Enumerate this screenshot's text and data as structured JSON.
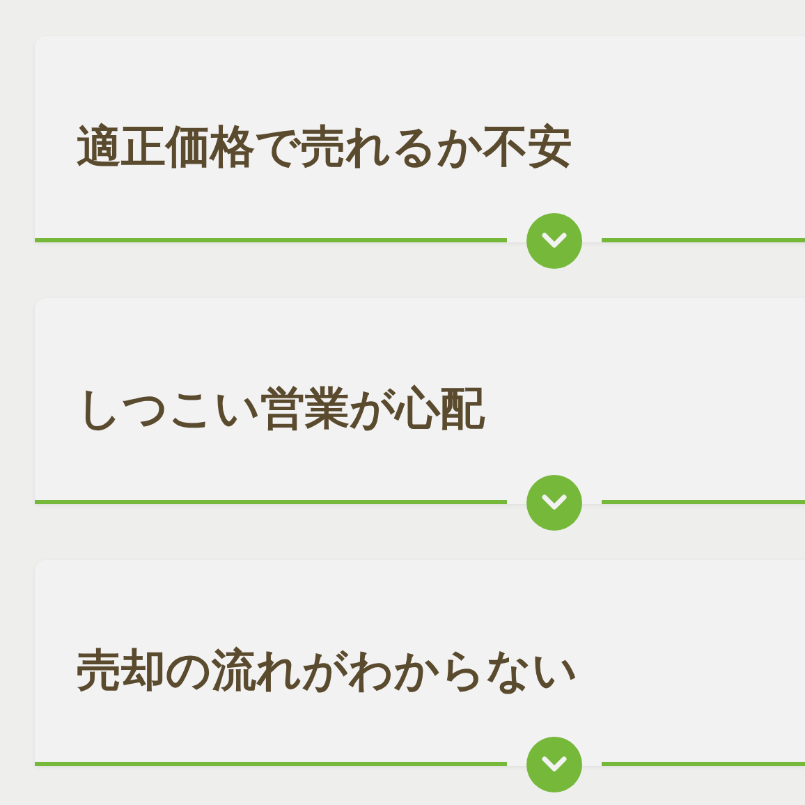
{
  "faq_items": [
    {
      "question": "適正価格で売れるか不安",
      "expanded": false
    },
    {
      "question": "しつこい営業が心配",
      "expanded": false
    },
    {
      "question": "売却の流れがわからない",
      "expanded": false
    }
  ]
}
